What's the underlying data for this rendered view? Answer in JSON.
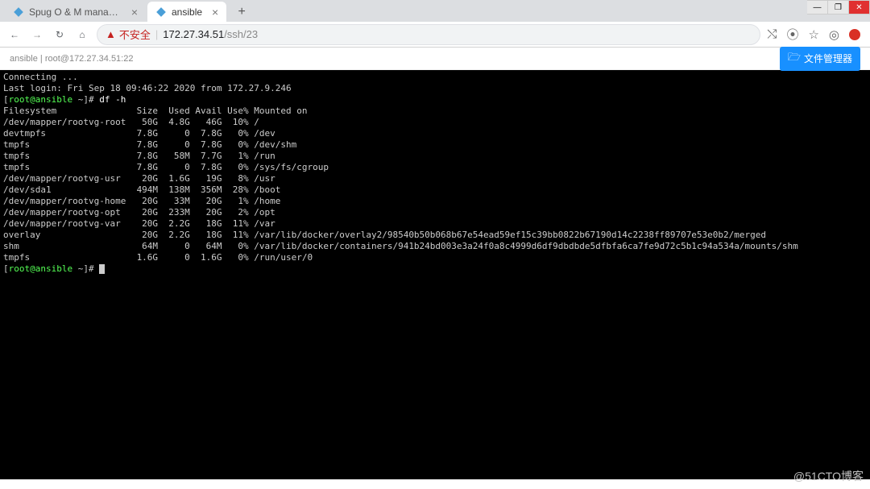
{
  "window": {
    "minimize": "—",
    "maximize": "❐",
    "close": "✕"
  },
  "tabs": [
    {
      "title": "Spug O & M management sys",
      "active": false
    },
    {
      "title": "ansible",
      "active": true
    }
  ],
  "new_tab": "+",
  "nav": {
    "back": "←",
    "forward": "→",
    "reload": "↻",
    "home": "⌂"
  },
  "address": {
    "insecure_icon": "▲",
    "insecure_text": "不安全",
    "sep": "|",
    "host": "172.27.34.51",
    "path": "/ssh/23"
  },
  "right_icons": {
    "translate": "⤭",
    "zoom": "⦿",
    "star": "☆",
    "ext": "◎"
  },
  "page_header": {
    "title": "ansible | root@172.27.34.51:22",
    "file_mgr_icon": "🗁",
    "file_mgr_label": "文件管理器"
  },
  "terminal": {
    "connecting": "Connecting ...",
    "last_login": "Last login: Fri Sep 18 09:46:22 2020 from 172.27.9.246",
    "prompt_open": "[",
    "prompt_user": "root@ansible",
    "prompt_path": " ~",
    "prompt_close": "]#",
    "cmd1": " df -h",
    "header": "Filesystem               Size  Used Avail Use% Mounted on",
    "rows": [
      "/dev/mapper/rootvg-root   50G  4.8G   46G  10% /",
      "devtmpfs                 7.8G     0  7.8G   0% /dev",
      "tmpfs                    7.8G     0  7.8G   0% /dev/shm",
      "tmpfs                    7.8G   58M  7.7G   1% /run",
      "tmpfs                    7.8G     0  7.8G   0% /sys/fs/cgroup",
      "/dev/mapper/rootvg-usr    20G  1.6G   19G   8% /usr",
      "/dev/sda1                494M  138M  356M  28% /boot",
      "/dev/mapper/rootvg-home   20G   33M   20G   1% /home",
      "/dev/mapper/rootvg-opt    20G  233M   20G   2% /opt",
      "/dev/mapper/rootvg-var    20G  2.2G   18G  11% /var",
      "overlay                   20G  2.2G   18G  11% /var/lib/docker/overlay2/98540b50b068b67e54ead59ef15c39bb0822b67190d14c2238ff89707e53e0b2/merged",
      "shm                       64M     0   64M   0% /var/lib/docker/containers/941b24bd003e3a24f0a8c4999d6df9dbdbde5dfbfa6ca7fe9d72c5b1c94a534a/mounts/shm",
      "tmpfs                    1.6G     0  1.6G   0% /run/user/0"
    ],
    "cmd2": " "
  },
  "watermark": "@51CTO博客"
}
